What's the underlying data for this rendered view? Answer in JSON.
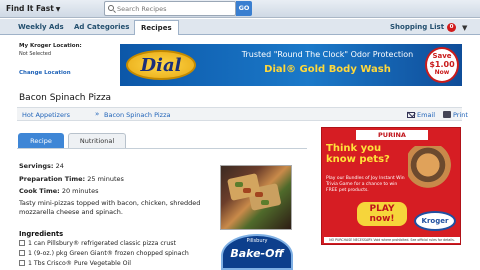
{
  "topbar": {
    "find_label": "Find It Fast",
    "find_caret": "▼",
    "search_placeholder": "Search Recipes",
    "go_label": "GO"
  },
  "nav": {
    "tabs": [
      {
        "label": "Weekly Ads"
      },
      {
        "label": "Ad Categories"
      },
      {
        "label": "Recipes"
      }
    ],
    "shopping_list_label": "Shopping List",
    "shopping_count": "0",
    "caret": "▼"
  },
  "location": {
    "title": "My Kroger Location:",
    "status": "Not Selected",
    "change_label": "Change Location"
  },
  "banner": {
    "brand": "Dial",
    "line1": "Trusted \"Round The Clock\" Odor Protection",
    "line2": "Dial® Gold Body Wash",
    "save_line1": "Save",
    "save_line2": "$1.00",
    "save_line3": "Now"
  },
  "recipe": {
    "title": "Bacon Spinach Pizza",
    "breadcrumb": [
      {
        "label": "Hot Appetizers"
      },
      {
        "label": "Bacon Spinach Pizza"
      }
    ],
    "breadcrumb_sep": "»",
    "email_label": "Email",
    "print_label": "Print",
    "tabs": [
      {
        "label": "Recipe"
      },
      {
        "label": "Nutritional"
      }
    ],
    "servings_label": "Servings:",
    "servings_value": "24",
    "prep_label": "Preparation Time:",
    "prep_value": "25 minutes",
    "cook_label": "Cook Time:",
    "cook_value": "20 minutes",
    "description": "Tasty mini-pizzas topped with bacon, chicken, shredded mozzarella cheese and spinach.",
    "ingredients_title": "Ingredients",
    "ingredients": [
      "1 can Pillsbury® refrigerated classic pizza crust",
      "1 (9-oz.) pkg Green Giant® frozen chopped spinach",
      "1 Tbs Crisco® Pure Vegetable Oil"
    ],
    "badge_small": "Pillsbury",
    "badge_big": "Bake-Off"
  },
  "ad": {
    "brand": "PURINA",
    "headline": "Think you know pets?",
    "body": "Play our Bundles of Joy Instant Win Trivia Game for a chance to win FREE pet products.",
    "play_label": "PLAY now!",
    "kroger_label": "Kroger",
    "fine_print": "NO PURCHASE NECESSARY. Void where prohibited. See official rules for details."
  },
  "colors": {
    "accent": "#3e86d6",
    "link": "#1e62b8",
    "badge_red": "#d21c1c",
    "ad_red": "#d61d23"
  }
}
